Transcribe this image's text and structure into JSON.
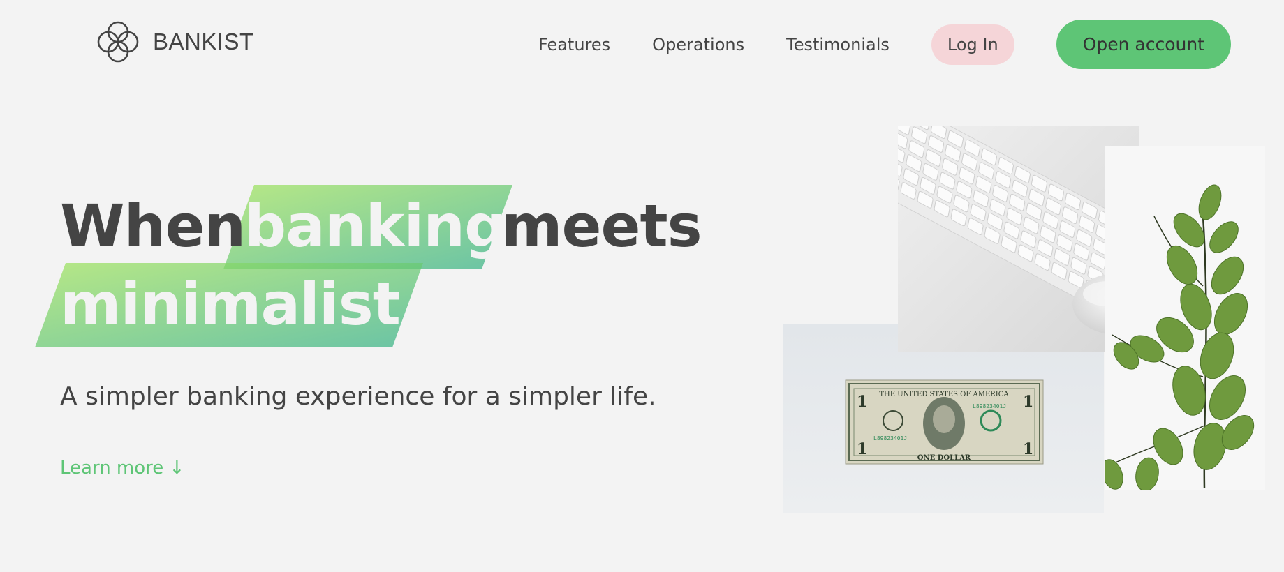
{
  "nav": {
    "brand": "BANKIST",
    "links": [
      {
        "label": "Features"
      },
      {
        "label": "Operations"
      },
      {
        "label": "Testimonials"
      }
    ],
    "login_label": "Log In",
    "open_account_label": "Open account"
  },
  "hero": {
    "title_word_1": "When",
    "title_highlight_1": "banking",
    "title_word_2": "meets",
    "title_highlight_2": "minimalist",
    "subtitle": "A simpler banking experience for a simpler life.",
    "learn_more": "Learn more ↓"
  },
  "colors": {
    "accent_green": "#5ec576",
    "login_pink": "#f5d5d8",
    "text_dark": "#444444",
    "background": "#f3f3f3"
  },
  "icons": {
    "logo": "bankist-logo-icon",
    "keyboard": "keyboard-mouse-image",
    "dollar": "dollar-bill-image",
    "plant": "eucalyptus-plant-image"
  },
  "images": {
    "dollar_text_top": "THE UNITED STATES OF AMERICA",
    "dollar_text_bottom": "ONE DOLLAR",
    "dollar_serial": "L89823401J",
    "dollar_number": "1"
  }
}
